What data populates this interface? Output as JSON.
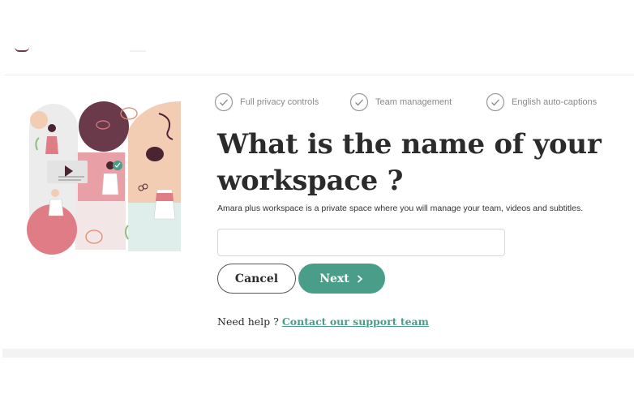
{
  "header": {
    "logo_name": "amara-logo"
  },
  "features": [
    {
      "label": "Full privacy controls",
      "icon": "check-circle-icon"
    },
    {
      "label": "Team management",
      "icon": "check-circle-icon"
    },
    {
      "label": "English auto-captions",
      "icon": "check-circle-icon"
    }
  ],
  "main": {
    "title": "What is the name of your workspace ?",
    "subtitle": "Amara plus workspace is a private space where you will manage your team, videos and subtitles.",
    "workspace_input": {
      "value": "",
      "placeholder": ""
    },
    "cancel_label": "Cancel",
    "next_label": "Next",
    "help_text": "Need help ?",
    "help_link": "Contact our support team"
  },
  "colors": {
    "accent": "#4a9d89",
    "illustration_pink": "#e07c86",
    "illustration_plum": "#6b3a4a",
    "illustration_peach": "#f2cdb3"
  }
}
